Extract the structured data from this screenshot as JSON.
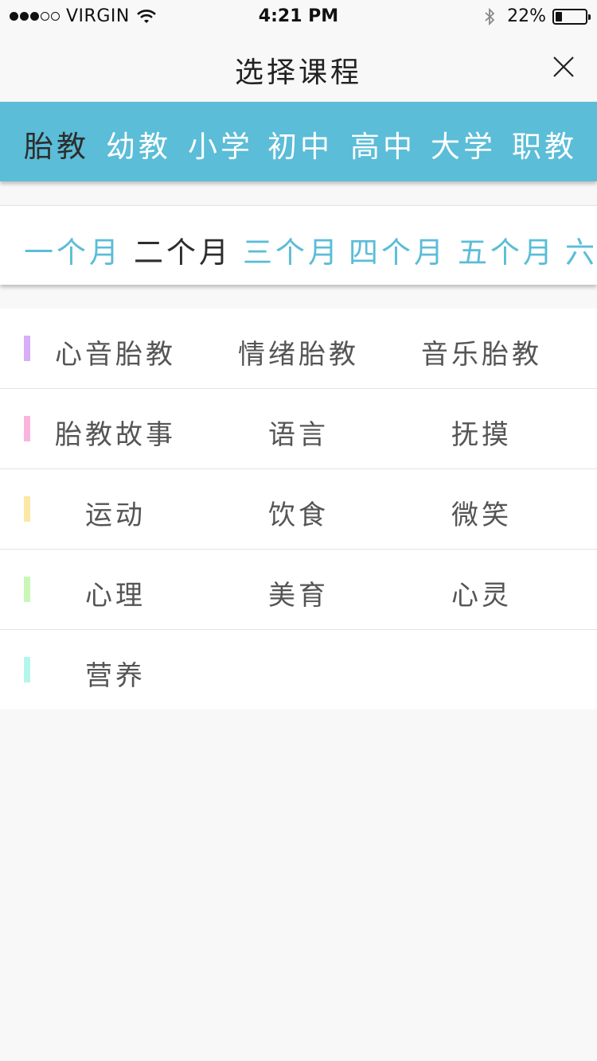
{
  "status_bar": {
    "carrier": "VIRGIN",
    "time": "4:21 PM",
    "battery_percent": "22%",
    "battery_level": 0.22,
    "signal_filled": 3,
    "signal_total": 5
  },
  "nav": {
    "title": "选择课程",
    "close_icon": "close-icon"
  },
  "levels": {
    "active_color": "#2d2d2d",
    "bar_color": "#5bbdd7",
    "items": [
      {
        "label": "胎教",
        "active": true
      },
      {
        "label": "幼教",
        "active": false
      },
      {
        "label": "小学",
        "active": false
      },
      {
        "label": "初中",
        "active": false
      },
      {
        "label": "高中",
        "active": false
      },
      {
        "label": "大学",
        "active": false
      },
      {
        "label": "职教",
        "active": false
      }
    ]
  },
  "months": {
    "accent_color": "#5bbdd7",
    "items": [
      {
        "label": "一个月",
        "active": false
      },
      {
        "label": "二个月",
        "active": true
      },
      {
        "label": "三个月",
        "active": false
      },
      {
        "label": "四个月",
        "active": false
      },
      {
        "label": "五个月",
        "active": false
      },
      {
        "label": "六",
        "active": false
      }
    ]
  },
  "courses": {
    "rows": [
      {
        "marker_color": "#d7aef7",
        "items": [
          "心音胎教",
          "情绪胎教",
          "音乐胎教"
        ]
      },
      {
        "marker_color": "#fbb5dc",
        "items": [
          "胎教故事",
          "语言",
          "抚摸"
        ]
      },
      {
        "marker_color": "#fbe8a6",
        "items": [
          "运动",
          "饮食",
          "微笑"
        ]
      },
      {
        "marker_color": "#c8f7b6",
        "items": [
          "心理",
          "美育",
          "心灵"
        ]
      },
      {
        "marker_color": "#b3f6ec",
        "items": [
          "营养"
        ]
      }
    ]
  }
}
